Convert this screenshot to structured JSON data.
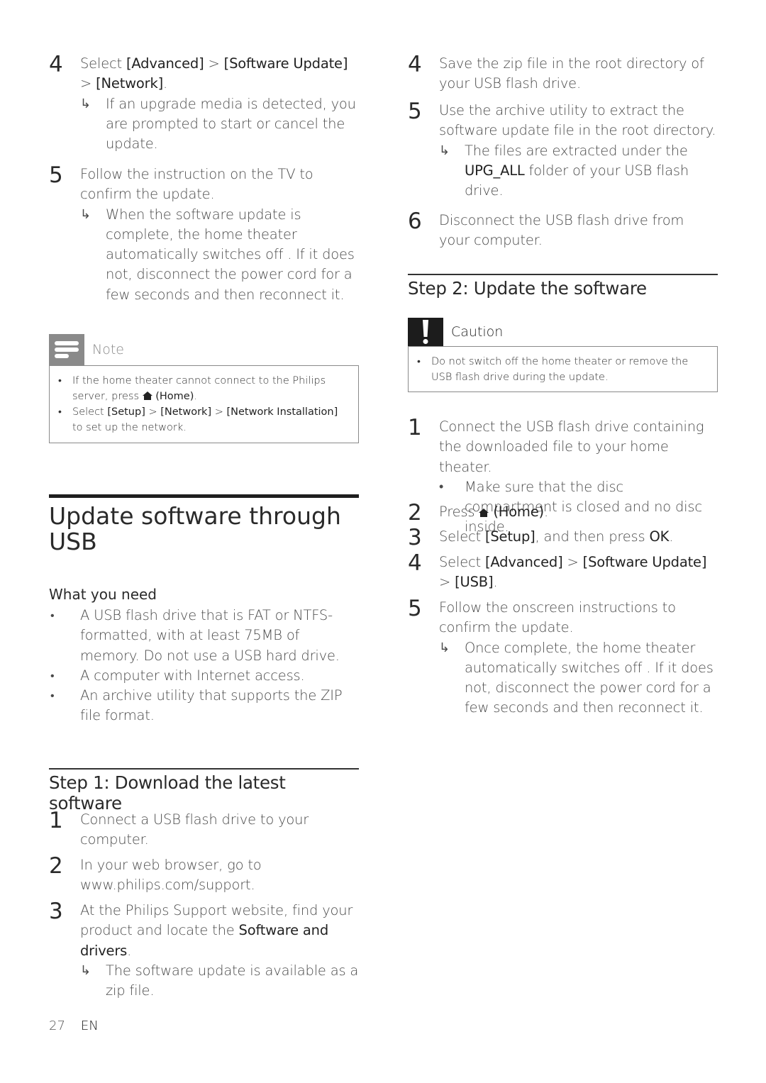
{
  "left": {
    "step4": {
      "num": "4",
      "text_pre": "Select ",
      "b1": "[Advanced]",
      "sep1": " > ",
      "b2": "[Software Update]",
      "sep2": " > ",
      "b3": "[Network]",
      "end": ".",
      "result": "If an upgrade media is detected, you are prompted to start or cancel the update."
    },
    "step5": {
      "num": "5",
      "text": "Follow the instruction on the TV to confirm the update.",
      "result": "When the software update is complete, the home theater automatically switches off . If it does not, disconnect the power cord for a few seconds and then reconnect it."
    },
    "note": {
      "title": "Note",
      "item1_pre": "If the home theater cannot connect to the Philips server, press ",
      "item1_b": "(Home)",
      "item1_end": ".",
      "item2_pre": "Select ",
      "item2_b1": "[Setup]",
      "item2_sep1": " > ",
      "item2_b2": "[Network]",
      "item2_sep2": " > ",
      "item2_b3": "[Network Installation]",
      "item2_end": " to set up the network."
    },
    "section_title_line1": "Update software through",
    "section_title_line2": "USB",
    "what_you_need": {
      "heading": "What you need",
      "items": [
        "A USB flash drive that is FAT or NTFS-formatted, with at least 75MB of memory. Do not use a USB hard drive.",
        "A computer with Internet access.",
        "An archive utility that supports the ZIP file format."
      ]
    },
    "step1_section": {
      "title": "Step 1: Download the latest software",
      "s1": {
        "num": "1",
        "text": "Connect a USB flash drive to your computer."
      },
      "s2": {
        "num": "2",
        "text": "In your web browser, go to www.philips.com/support."
      },
      "s3": {
        "num": "3",
        "text_pre": "At the Philips Support website, find your product and locate the ",
        "b": "Software and drivers",
        "end": ".",
        "result": "The software update is available as a zip file."
      }
    }
  },
  "right": {
    "step4": {
      "num": "4",
      "text": "Save the zip file in the root directory of your USB flash drive."
    },
    "step5": {
      "num": "5",
      "text": "Use the archive utility to extract the software update file in the root directory.",
      "result_pre": "The files are extracted under the ",
      "result_b": "UPG_ALL",
      "result_end": " folder of your USB flash drive."
    },
    "step6": {
      "num": "6",
      "text": "Disconnect the USB flash drive from your computer."
    },
    "step2_section": {
      "title": "Step 2: Update the software",
      "caution": {
        "title": "Caution",
        "item": "Do not switch off the home theater or remove the USB flash drive during the update."
      },
      "s1": {
        "num": "1",
        "text": "Connect the USB flash drive containing the downloaded file to your home theater.",
        "bullet": "Make sure that the disc compartment is closed and no disc inside."
      },
      "s2": {
        "num": "2",
        "pre": "Press ",
        "b": "(Home)",
        "end": "."
      },
      "s3": {
        "num": "3",
        "pre": "Select ",
        "b": "[Setup]",
        "mid": ", and then press ",
        "b2": "OK",
        "end": "."
      },
      "s4": {
        "num": "4",
        "pre": "Select ",
        "b1": "[Advanced]",
        "sep1": " > ",
        "b2": "[Software Update]",
        "sep2": " > ",
        "b3": "[USB]",
        "end": "."
      },
      "s5": {
        "num": "5",
        "text": "Follow the onscreen instructions to confirm the update.",
        "result": "Once complete, the home theater automatically switches off . If it does not, disconnect the power cord for a few seconds and then reconnect it."
      }
    }
  },
  "footer": {
    "page": "27",
    "lang": "EN"
  },
  "icons": {
    "result_arrow": "↳",
    "bullet": "•"
  }
}
